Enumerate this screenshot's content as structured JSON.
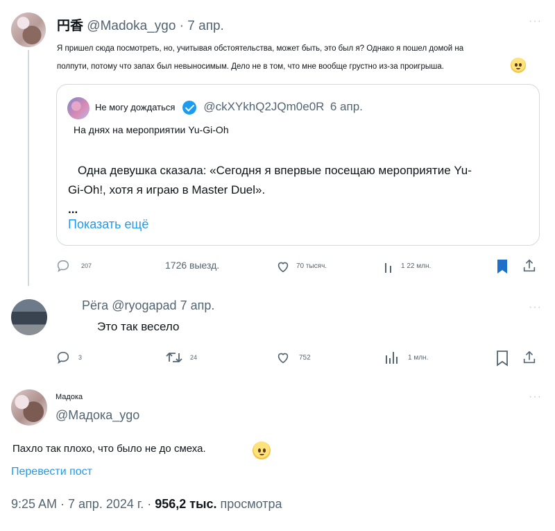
{
  "tweet1": {
    "display_name": "円香",
    "handle": "@Madoka_ygo",
    "date": "· 7 апр.",
    "text_line1": "Я пришел сюда посмотреть, но, учитывая обстоятельства, может быть, это был я? Однако я пошел домой на",
    "text_line2": "полпути, потому что запах был невыносимым. Дело не в том, что мне вообще грустно из-за проигрыша.",
    "quote": {
      "display_name": "Не могу дождаться",
      "handle": "@ckXYkhQ2JQm0e0R",
      "date": "6 апр.",
      "line1": "На днях на мероприятии Yu-Gi-Oh",
      "line2": "Одна девушка сказала: «Сегодня я впервые посещаю мероприятие Yu-",
      "line3": "Gi-Oh!, хотя я играю в Master Duel».",
      "line4": "...",
      "show_more": "Показать ещё"
    },
    "actions": {
      "replies": "207",
      "retweets": "1726 выезд.",
      "likes": "70 тысяч.",
      "views": "1 22 млн."
    }
  },
  "tweet2": {
    "display_name": "Рёга",
    "handle": "@ryogapad",
    "date": "7 апр.",
    "text": "Это так весело",
    "actions": {
      "replies": "3",
      "retweets": "24",
      "likes": "752",
      "views": "1 млн."
    }
  },
  "main": {
    "display_name": "Мадока",
    "handle": "@Мадока_ygo",
    "text": "Пахло так плохо, что было не до смеха.",
    "translate": "Перевести пост",
    "time": "9:25 AM · 7 апр. 2024 г. ·",
    "views_count": "956,2 тыс.",
    "views_label": "просмотра"
  },
  "colors": {
    "accent": "#1d9bf0",
    "muted": "#536471",
    "border": "#cfd9de"
  }
}
